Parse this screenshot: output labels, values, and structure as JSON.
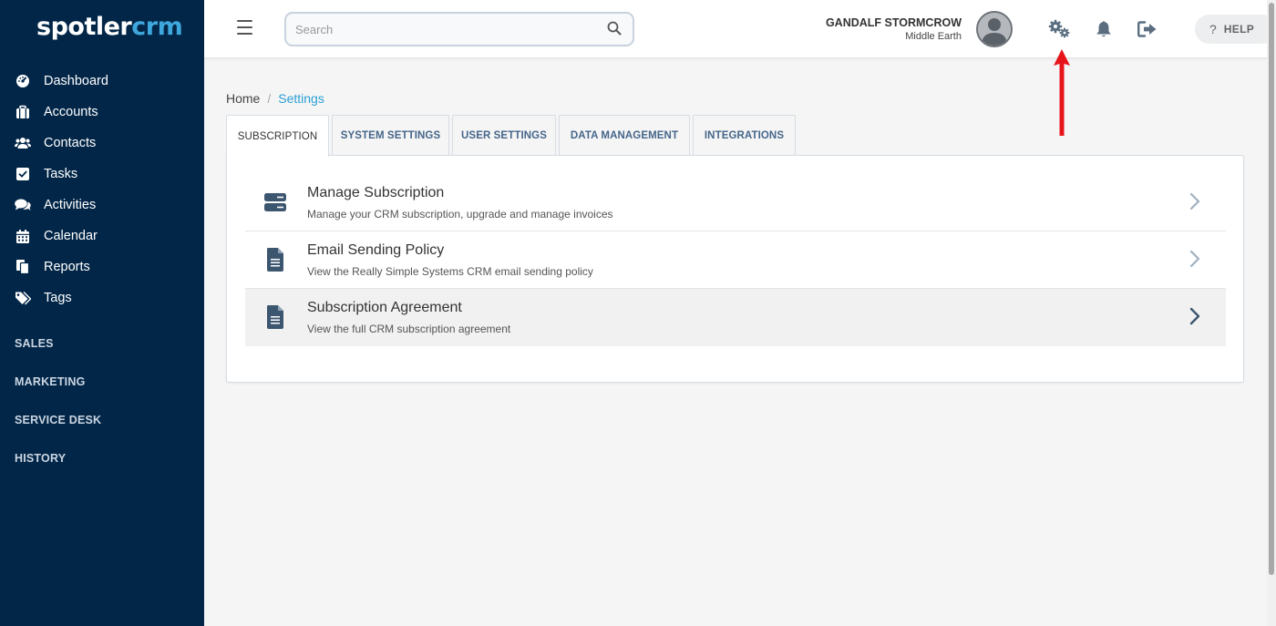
{
  "brand": {
    "part1": "spotler",
    "part2": "crm"
  },
  "sidebar": {
    "items": [
      {
        "label": "Dashboard",
        "icon": "dashboard-icon"
      },
      {
        "label": "Accounts",
        "icon": "briefcase-icon"
      },
      {
        "label": "Contacts",
        "icon": "users-icon"
      },
      {
        "label": "Tasks",
        "icon": "checkbox-icon"
      },
      {
        "label": "Activities",
        "icon": "comments-icon"
      },
      {
        "label": "Calendar",
        "icon": "calendar-icon"
      },
      {
        "label": "Reports",
        "icon": "copy-icon"
      },
      {
        "label": "Tags",
        "icon": "tags-icon"
      }
    ],
    "sections": [
      "SALES",
      "MARKETING",
      "SERVICE DESK",
      "HISTORY"
    ]
  },
  "header": {
    "search_placeholder": "Search",
    "user_name": "GANDALF STORMCROW",
    "user_location": "Middle Earth",
    "help_label": "HELP",
    "help_glyph": "?"
  },
  "breadcrumb": {
    "home": "Home",
    "separator": "/",
    "current": "Settings"
  },
  "tabs": [
    {
      "label": "SUBSCRIPTION",
      "active": true
    },
    {
      "label": "SYSTEM SETTINGS",
      "active": false
    },
    {
      "label": "USER SETTINGS",
      "active": false
    },
    {
      "label": "DATA MANAGEMENT",
      "active": false
    },
    {
      "label": "INTEGRATIONS",
      "active": false
    }
  ],
  "settings_rows": [
    {
      "title": "Manage Subscription",
      "description": "Manage your CRM subscription, upgrade and manage invoices",
      "icon": "server-icon"
    },
    {
      "title": "Email Sending Policy",
      "description": "View the Really Simple Systems CRM email sending policy",
      "icon": "document-icon"
    },
    {
      "title": "Subscription Agreement",
      "description": "View the full CRM subscription agreement",
      "icon": "document-icon"
    }
  ],
  "colors": {
    "sidebar_bg": "#022648",
    "accent": "#2a9fd6",
    "brand_crm": "#3ea8dc",
    "annotation_arrow": "#e8141b"
  }
}
